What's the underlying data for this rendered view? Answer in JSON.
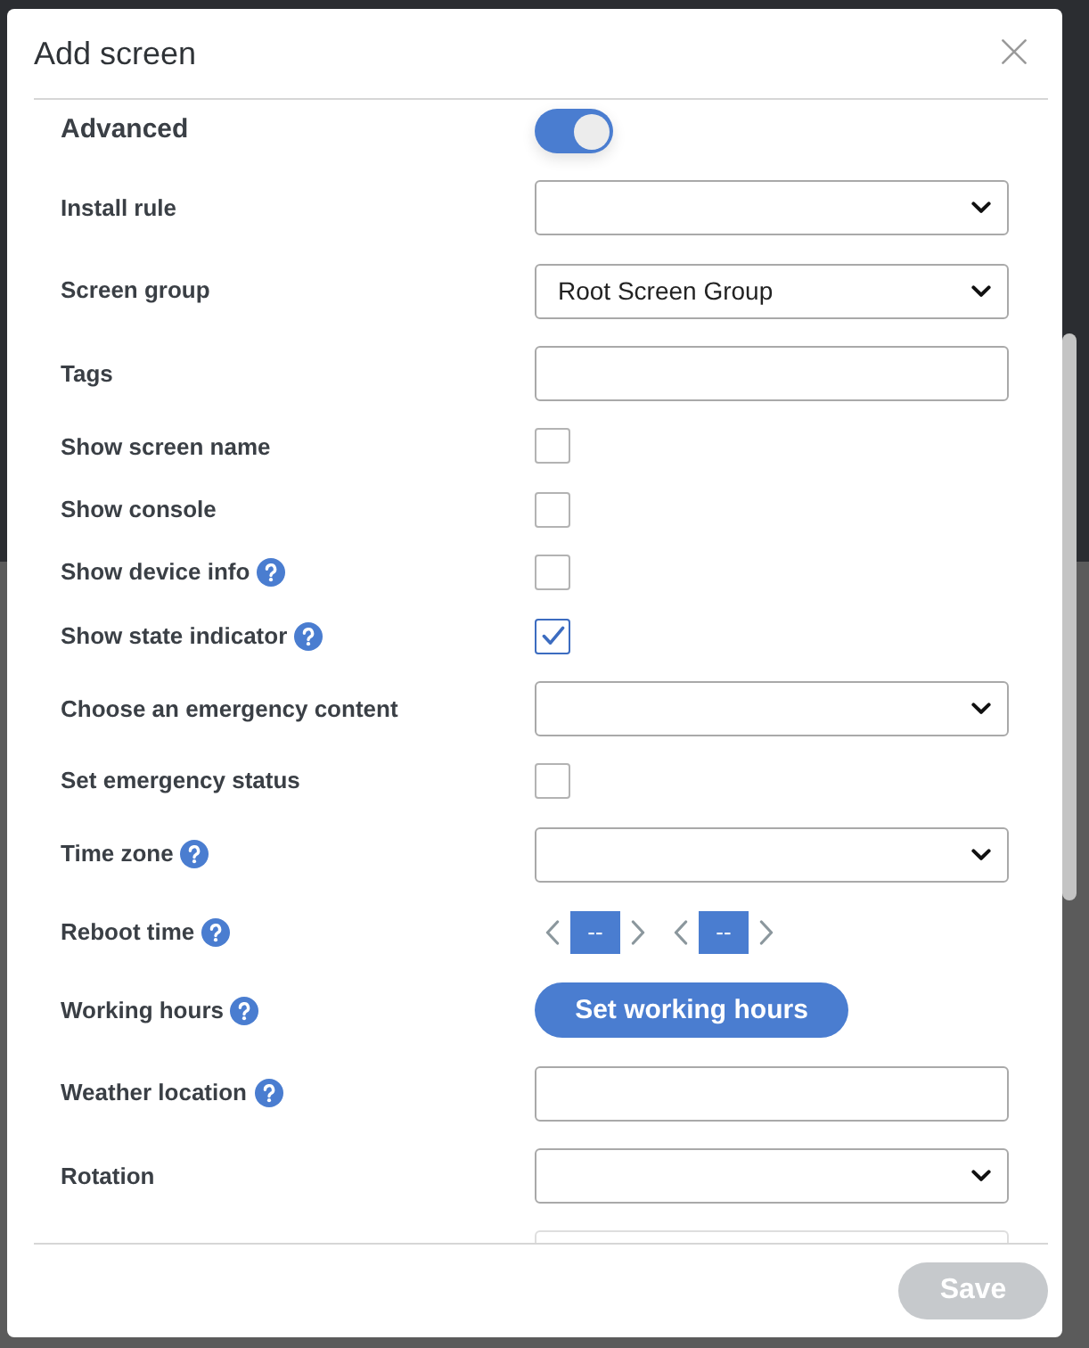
{
  "dialog": {
    "title": "Add screen"
  },
  "fields": [
    {
      "kind": "toggle",
      "label": "Advanced",
      "help": false,
      "on": true
    },
    {
      "kind": "select",
      "label": "Install rule",
      "help": false
    },
    {
      "kind": "select",
      "label": "Screen group",
      "help": false,
      "value": "Root Screen Group"
    },
    {
      "kind": "input",
      "label": "Tags",
      "help": false
    },
    {
      "kind": "checkbox",
      "label": "Show screen name",
      "help": false,
      "checked": false
    },
    {
      "kind": "checkbox",
      "label": "Show console",
      "help": false,
      "checked": false
    },
    {
      "kind": "checkbox",
      "label": "Show device info",
      "help": true,
      "checked": false
    },
    {
      "kind": "checkbox",
      "label": "Show state indicator",
      "help": true,
      "checked": true
    },
    {
      "kind": "select",
      "label": "Choose an emergency content",
      "help": false
    },
    {
      "kind": "checkbox",
      "label": "Set emergency status",
      "help": false,
      "checked": false
    },
    {
      "kind": "select",
      "label": "Time zone",
      "help": true
    },
    {
      "kind": "spinners",
      "label": "Reboot time",
      "help": true,
      "values": [
        "--",
        "--"
      ]
    },
    {
      "kind": "button",
      "label": "Working hours",
      "help": true,
      "button": "Set working hours"
    },
    {
      "kind": "input",
      "label": "Weather location",
      "help": true
    },
    {
      "kind": "select",
      "label": "Rotation",
      "help": false
    },
    {
      "kind": "input",
      "cut_off": true
    }
  ],
  "footer": {
    "save": {
      "label": "Save",
      "disabled": true
    }
  }
}
